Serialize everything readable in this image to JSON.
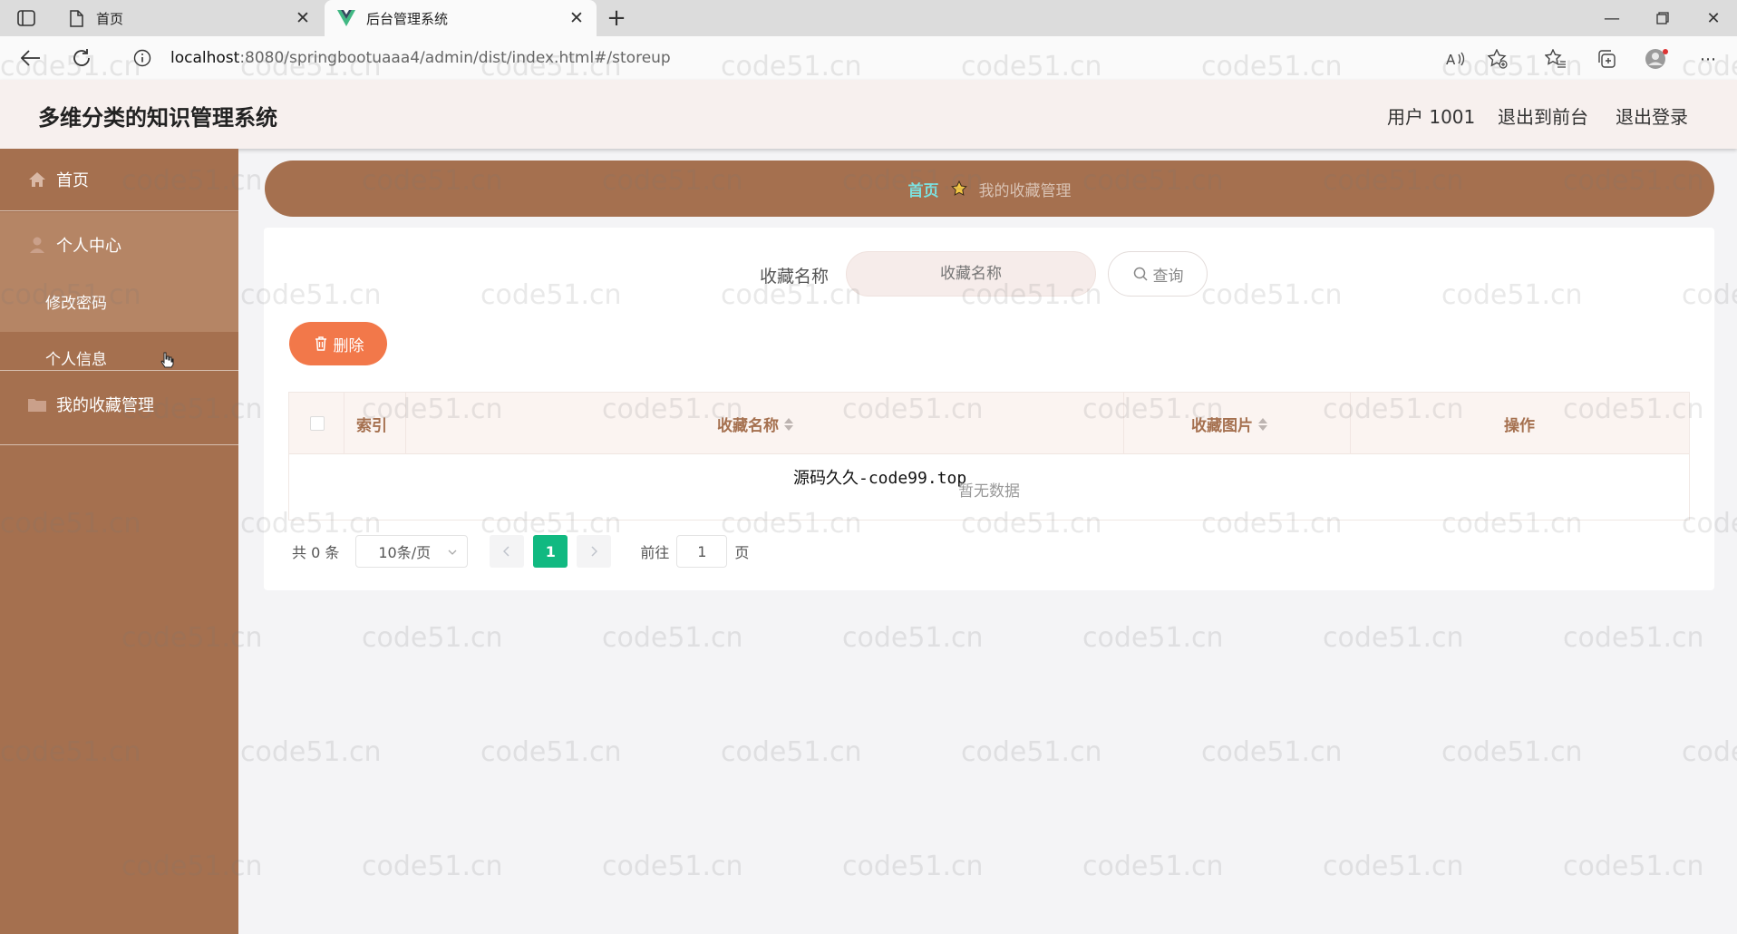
{
  "browser": {
    "tabs": [
      {
        "label": "首页",
        "active": false
      },
      {
        "label": "后台管理系统",
        "active": true
      }
    ],
    "url_host": "localhost",
    "url_path": ":8080/springbootuaaa4/admin/dist/index.html#/storeup"
  },
  "header": {
    "title": "多维分类的知识管理系统",
    "user": "用户 1001",
    "to_front": "退出到前台",
    "logout": "退出登录"
  },
  "sidebar": {
    "home": "首页",
    "personal_center": "个人中心",
    "change_password": "修改密码",
    "personal_info": "个人信息",
    "favorites": "我的收藏管理"
  },
  "breadcrumb": {
    "home": "首页",
    "current": "我的收藏管理"
  },
  "search": {
    "label": "收藏名称",
    "placeholder": "收藏名称",
    "button": "查询"
  },
  "actions": {
    "delete": "删除"
  },
  "table": {
    "columns": [
      "索引",
      "收藏名称",
      "收藏图片",
      "操作"
    ],
    "overlay_text": "源码久久-code99.top",
    "empty_text": "暂无数据"
  },
  "pagination": {
    "total": "共 0 条",
    "page_size": "10条/页",
    "current_page": "1",
    "goto_prefix": "前往",
    "goto_value": "1",
    "goto_suffix": "页"
  },
  "watermark": "code51.cn",
  "colors": {
    "sidebar": "#a5704f",
    "accent_delete": "#f2784a",
    "active_page": "#11b981",
    "breadcrumb_home": "#7de0de"
  }
}
